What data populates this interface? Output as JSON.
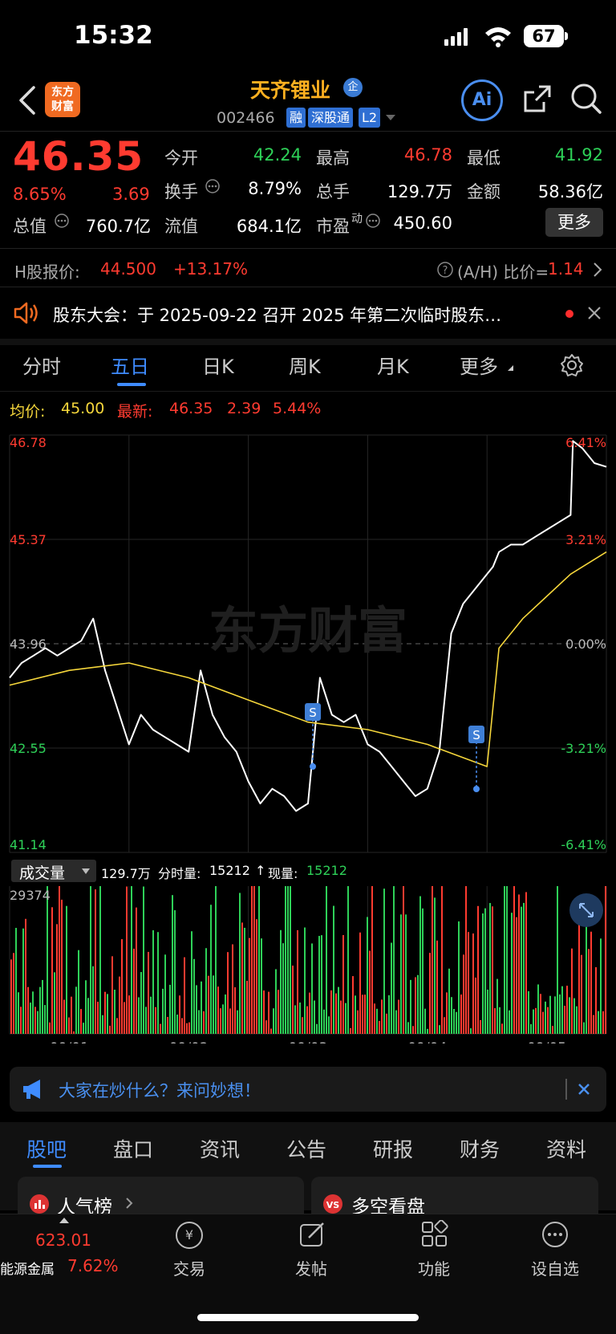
{
  "status_bar": {
    "time": "15:32",
    "battery": "67"
  },
  "header": {
    "logo_line1": "东方",
    "logo_line2": "财富",
    "name": "天齐锂业",
    "badge": "企",
    "code": "002466",
    "tags": [
      "融",
      "深股通",
      "L2"
    ],
    "ai_label": "Ai"
  },
  "quote": {
    "price": "46.35",
    "change_pct": "8.65%",
    "change": "3.69",
    "rows": [
      [
        {
          "label": "今开",
          "value": "42.24",
          "color": "green"
        },
        {
          "label": "最高",
          "value": "46.78",
          "color": "red"
        },
        {
          "label": "最低",
          "value": "41.92",
          "color": "green"
        }
      ],
      [
        {
          "label": "换手",
          "value": "8.79%",
          "color": "white"
        },
        {
          "label": "总手",
          "value": "129.7万",
          "color": "white"
        },
        {
          "label": "金额",
          "value": "58.36亿",
          "color": "white"
        }
      ],
      [
        {
          "label": "总值",
          "value": "760.7亿",
          "color": "white"
        },
        {
          "label": "流值",
          "value": "684.1亿",
          "color": "white"
        },
        {
          "label": "市盈",
          "value": "450.60",
          "color": "white"
        }
      ]
    ],
    "pe_superscript": "动",
    "more_button": "更多"
  },
  "h_share": {
    "label": "H股报价:",
    "price": "44.500",
    "pct": "+13.17%",
    "ratio_label": "(A/H) 比价=",
    "ratio": "1.14"
  },
  "notice": {
    "text": "股东大会：于 2025-09-22 召开 2025 年第二次临时股东…"
  },
  "chart_tabs": [
    "分时",
    "五日",
    "日K",
    "周K",
    "月K",
    "更多"
  ],
  "active_chart_tab": "五日",
  "legend": {
    "avg_label": "均价:",
    "avg_value": "45.00",
    "latest_label": "最新:",
    "latest_value": "46.35",
    "latest_change": "2.39",
    "latest_pct": "5.44%"
  },
  "watermark": "东方财富",
  "chart_data": {
    "type": "line",
    "title": "",
    "days": [
      "09/01",
      "09/02",
      "09/03",
      "09/04",
      "09/05"
    ],
    "y_ticks_left": [
      "46.78",
      "45.37",
      "43.96",
      "42.55",
      "41.14"
    ],
    "y_ticks_right": [
      "6.41%",
      "3.21%",
      "0.00%",
      "-3.21%",
      "-6.41%"
    ],
    "ylim": [
      41.14,
      46.78
    ],
    "prev_close": 43.96,
    "series": [
      {
        "name": "price",
        "color": "#ffffff",
        "x": [
          0,
          0.1,
          0.2,
          0.3,
          0.4,
          0.5,
          0.6,
          0.7,
          0.8,
          0.9,
          1.0,
          1.1,
          1.2,
          1.3,
          1.4,
          1.5,
          1.6,
          1.7,
          1.8,
          1.9,
          2.0,
          2.1,
          2.2,
          2.3,
          2.4,
          2.5,
          2.6,
          2.7,
          2.8,
          2.9,
          3.0,
          3.1,
          3.2,
          3.3,
          3.4,
          3.5,
          3.6,
          3.7,
          3.8,
          3.9,
          4.0,
          4.05,
          4.1,
          4.2,
          4.3,
          4.4,
          4.5,
          4.6,
          4.7,
          4.72,
          4.8,
          4.9,
          5.0
        ],
        "values": [
          43.5,
          43.7,
          43.8,
          43.9,
          43.8,
          43.9,
          44.0,
          44.3,
          43.6,
          43.1,
          42.6,
          43.0,
          42.8,
          42.7,
          42.6,
          42.5,
          43.6,
          43.0,
          42.7,
          42.5,
          42.1,
          41.8,
          42.0,
          41.9,
          41.7,
          41.8,
          43.5,
          43.0,
          42.9,
          43.0,
          42.6,
          42.5,
          42.3,
          42.1,
          41.9,
          42.0,
          42.5,
          44.1,
          44.5,
          44.7,
          44.9,
          45.0,
          45.2,
          45.3,
          45.3,
          45.4,
          45.5,
          45.6,
          45.7,
          46.7,
          46.6,
          46.4,
          46.35
        ]
      },
      {
        "name": "avg",
        "color": "#f5d63b",
        "x": [
          0,
          0.5,
          1.0,
          1.5,
          2.0,
          2.5,
          3.0,
          3.5,
          4.0,
          4.1,
          4.3,
          4.5,
          4.7,
          5.0
        ],
        "values": [
          43.4,
          43.6,
          43.7,
          43.5,
          43.2,
          42.9,
          42.8,
          42.6,
          42.3,
          43.9,
          44.3,
          44.6,
          44.9,
          45.2
        ]
      }
    ]
  },
  "volume": {
    "selector": "成交量",
    "total": "129.7万",
    "minute_label": "分时量:",
    "minute_value": "15212",
    "current_label": "现量:",
    "current_value": "15212",
    "arrow": "↑",
    "max_label": "29374"
  },
  "promo": {
    "text": "大家在炒什么？来问妙想！"
  },
  "bottom_tabs": [
    "股吧",
    "盘口",
    "资讯",
    "公告",
    "研报",
    "财务",
    "资料"
  ],
  "active_bottom_tab": "股吧",
  "cards": [
    {
      "title": "人气榜"
    },
    {
      "title": "多空看盘"
    }
  ],
  "footer": {
    "index_value": "623.01",
    "index_name": "能源金属",
    "index_pct": "7.62%",
    "nav": [
      "交易",
      "发帖",
      "功能",
      "设自选"
    ]
  }
}
